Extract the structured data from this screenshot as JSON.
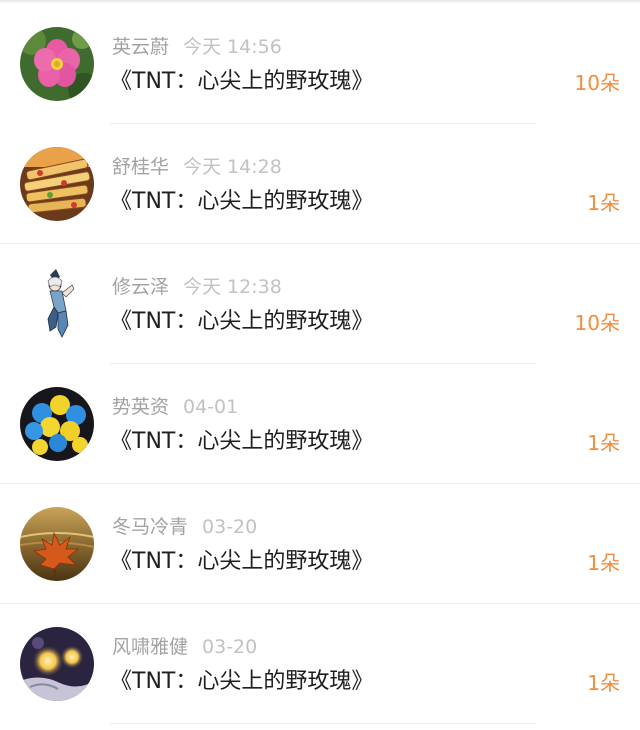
{
  "gift_list": [
    {
      "user": "英云蔚",
      "time": "今天 14:56",
      "title": "《TNT：心尖上的野玫瑰》",
      "count": "10朵",
      "avatar": "flower-photo"
    },
    {
      "user": "舒桂华",
      "time": "今天 14:28",
      "title": "《TNT：心尖上的野玫瑰》",
      "count": "1朵",
      "avatar": "food-skewers-photo"
    },
    {
      "user": "修云泽",
      "time": "今天 12:38",
      "title": "《TNT：心尖上的野玫瑰》",
      "count": "10朵",
      "avatar": "anime-figure-illustration"
    },
    {
      "user": "势英资",
      "time": "04-01",
      "title": "《TNT：心尖上的野玫瑰》",
      "count": "1朵",
      "avatar": "balloons-photo"
    },
    {
      "user": "冬马冷青",
      "time": "03-20",
      "title": "《TNT：心尖上的野玫瑰》",
      "count": "1朵",
      "avatar": "autumn-leaf-photo"
    },
    {
      "user": "风啸雅健",
      "time": "03-20",
      "title": "《TNT：心尖上的野玫瑰》",
      "count": "1朵",
      "avatar": "night-lights-photo"
    }
  ],
  "colors": {
    "count_accent": "#f28c3c",
    "username": "#a3a3a3",
    "timestamp": "#c2c2c2",
    "title_text": "#1e1e1e"
  }
}
